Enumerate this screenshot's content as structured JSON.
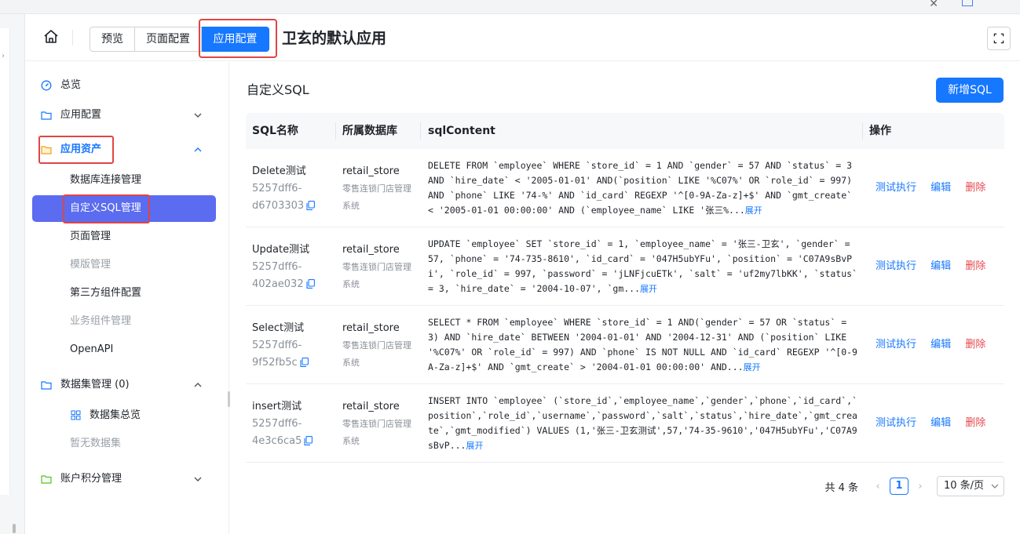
{
  "header": {
    "tabs": [
      {
        "label": "预览"
      },
      {
        "label": "页面配置"
      },
      {
        "label": "应用配置",
        "active": true
      }
    ],
    "app_title": "卫玄的默认应用"
  },
  "sidebar": {
    "items": [
      {
        "label": "总览",
        "icon": "dashboard-icon"
      },
      {
        "label": "应用配置",
        "icon": "folder-icon",
        "chevron": "down"
      },
      {
        "label": "应用资产",
        "icon": "folder-open-icon",
        "chevron": "up",
        "active": true
      },
      {
        "label": "数据集管理 (0)",
        "icon": "folder-icon",
        "chevron": "up"
      },
      {
        "label": "账户积分管理",
        "icon": "folder-icon",
        "chevron": "down"
      }
    ],
    "assets_children": [
      {
        "label": "数据库连接管理"
      },
      {
        "label": "自定义SQL管理",
        "active": true
      },
      {
        "label": "页面管理"
      },
      {
        "label": "模版管理",
        "disabled": true
      },
      {
        "label": "第三方组件配置"
      },
      {
        "label": "业务组件管理",
        "disabled": true
      },
      {
        "label": "OpenAPI"
      }
    ],
    "dataset_children": [
      {
        "label": "数据集总览",
        "icon": "grid-icon"
      },
      {
        "label": "暂无数据集",
        "disabled": true
      }
    ]
  },
  "main": {
    "title": "自定义SQL",
    "add_button": "新增SQL",
    "columns": [
      "SQL名称",
      "所属数据库",
      "sqlContent",
      "操作"
    ],
    "rows": [
      {
        "name": "Delete测试",
        "id1": "5257dff6-",
        "id2": "d6703303",
        "db": "retail_store",
        "db_desc": "零售连锁门店管理系统",
        "sql": "DELETE FROM `employee` WHERE `store_id` = 1 AND `gender` = 57 AND `status` = 3 AND `hire_date` < '2005-01-01' AND(`position` LIKE '%C07%' OR `role_id` = 997) AND `phone` LIKE '74-%' AND `id_card` REGEXP '^[0-9A-Za-z]+$' AND `gmt_create` < '2005-01-01 00:00:00' AND (`employee_name` LIKE '张三%..."
      },
      {
        "name": "Update测试",
        "id1": "5257dff6-",
        "id2": "402ae032",
        "db": "retail_store",
        "db_desc": "零售连锁门店管理系统",
        "sql": "UPDATE `employee` SET `store_id` = 1, `employee_name` = '张三-卫玄', `gender` = 57, `phone` = '74-735-8610', `id_card` = '047H5ubYFu', `position` = 'C07A9sBvPi', `role_id` = 997, `password` = 'jLNFjcuETk', `salt` = 'uf2my7lbKK', `status` = 3, `hire_date` = '2004-10-07', `gm..."
      },
      {
        "name": "Select测试",
        "id1": "5257dff6-",
        "id2": "9f52fb5c",
        "db": "retail_store",
        "db_desc": "零售连锁门店管理系统",
        "sql": "SELECT * FROM `employee` WHERE `store_id` = 1 AND(`gender` = 57 OR `status` = 3) AND `hire_date` BETWEEN '2004-01-01' AND '2004-12-31' AND (`position` LIKE '%C07%' OR `role_id` = 997) AND `phone` IS NOT NULL AND `id_card` REGEXP '^[0-9A-Za-z]+$' AND `gmt_create` > '2004-01-01 00:00:00' AND..."
      },
      {
        "name": "insert测试",
        "id1": "5257dff6-",
        "id2": "4e3c6ca5",
        "db": "retail_store",
        "db_desc": "零售连锁门店管理系统",
        "sql": "INSERT INTO `employee` (`store_id`,`employee_name`,`gender`,`phone`,`id_card`,`position`,`role_id`,`username`,`password`,`salt`,`status`,`hire_date`,`gmt_create`,`gmt_modified`) VALUES (1,'张三-卫玄测试',57,'74-35-9610','047H5ubYFu','C07A9sBvP..."
      }
    ],
    "row_actions": {
      "test": "测试执行",
      "edit": "编辑",
      "delete": "删除"
    },
    "expand_label": "展开"
  },
  "pagination": {
    "total": "共 4 条",
    "current": "1",
    "page_size": "10 条/页"
  },
  "colors": {
    "primary": "#1677ff",
    "active_menu": "#5b6cf0",
    "danger": "#e5484d",
    "highlight": "#e04545"
  }
}
